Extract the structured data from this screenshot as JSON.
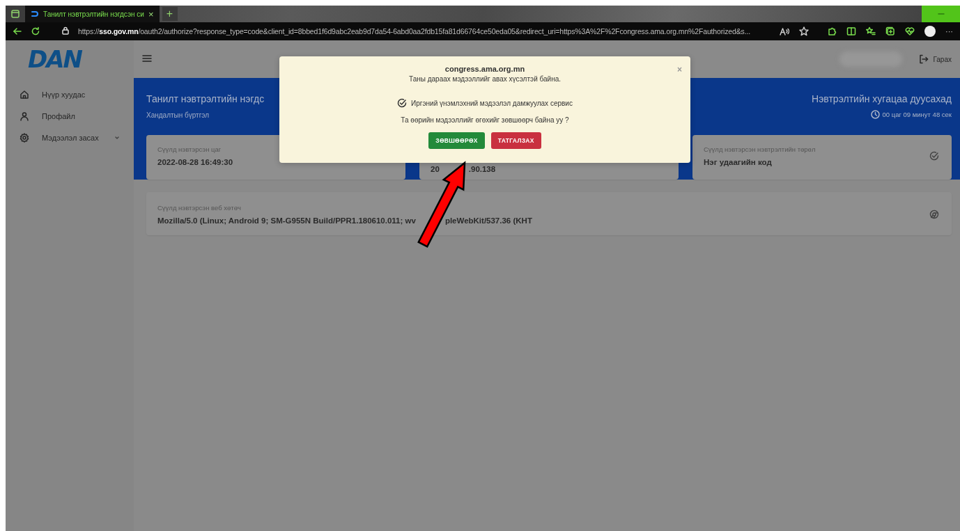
{
  "browser": {
    "tab_title": "Танилт нэвтрэлтийн нэгдсэн си",
    "tab_close": "×",
    "new_tab": "+",
    "url": "https://**sso.gov.mn**/oauth2/authorize?response_type=code&client_id=8bbed1f6d9abc2eab9d7da54-6abd0aa2fdb15fa81d66764ce50eda05&redirect_uri=https%3A%2F%2Fcongress.ama.org.mn%2Fauthorized&s...",
    "more": "···"
  },
  "sidebar": {
    "logo": "DAN",
    "items": [
      {
        "label": "Нүүр хуудас",
        "kind": "home",
        "expandable": false
      },
      {
        "label": "Профайл",
        "kind": "profile",
        "expandable": false
      },
      {
        "label": "Мэдээлэл засах",
        "kind": "settings",
        "expandable": true
      }
    ]
  },
  "header": {
    "logout": "Гарах"
  },
  "banner": {
    "title": "Танилт нэвтрэлтийн нэгдс",
    "subtitle": "Хандалтын бүртгэл",
    "session_title": "Нэвтрэлтийн хугацаа дуусахад",
    "countdown": "00 цаг 09 минут 48 сек"
  },
  "cards": [
    {
      "kind": "time",
      "label": "Сүүлд нэвтэрсэн цаг",
      "value_parts": [
        "2022-08-28 16:49:30"
      ]
    },
    {
      "kind": "covered",
      "value_parts": [
        "20",
        ".90.138"
      ]
    },
    {
      "kind": "method",
      "label": "Сүүлд нэвтэрсэн нэвтрэлтийн төрөл",
      "value_parts": [
        "Нэг удаагийн код"
      ]
    },
    {
      "kind": "browser",
      "label": "Сүүлд нэвтэрсэн веб хөтөч",
      "value_parts": [
        "Mozilla/5.0 (Linux; Android 9; SM-G955N Build/PPR1.180610.011; wv",
        "pleWebKit/537.36 (KHT"
      ]
    }
  ],
  "dialog": {
    "site": "congress.ama.org.mn",
    "request": "Таны дараах мэдээллийг авах хүсэлтэй байна.",
    "close": "×",
    "scopes": [
      {
        "label": "Иргэний үнэмлэхний мэдээлэл дамжуулах сервис",
        "checked": true
      }
    ],
    "question": "Та өөрийн мэдээллийг өгөхийг зөвшөөрч байна уу ?",
    "buttons": [
      {
        "label": "ЗӨВШӨӨРӨХ",
        "kind": "accept"
      },
      {
        "label": "ТАТГАЛЗАХ",
        "kind": "decline"
      }
    ]
  }
}
